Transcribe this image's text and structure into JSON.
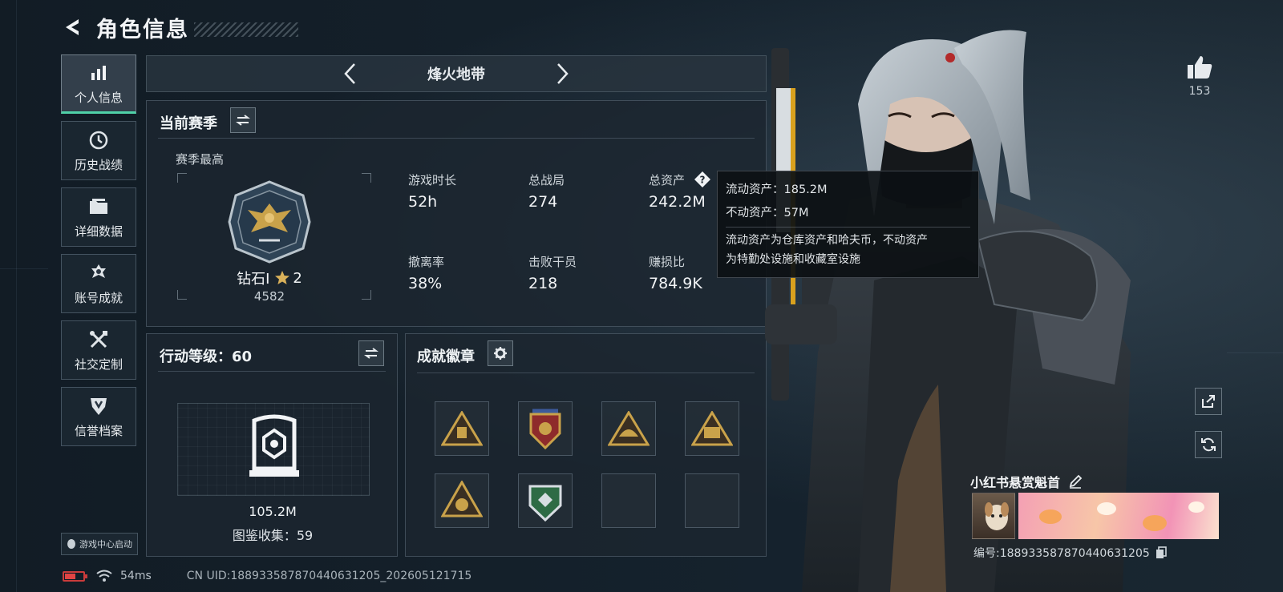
{
  "header": {
    "title": "角色信息"
  },
  "nav": {
    "items": [
      {
        "label": "个人信息",
        "icon": "bar-chart-icon",
        "active": true
      },
      {
        "label": "历史战绩",
        "icon": "clock-icon",
        "active": false
      },
      {
        "label": "详细数据",
        "icon": "folder-icon",
        "active": false
      },
      {
        "label": "账号成就",
        "icon": "medal-icon",
        "active": false
      },
      {
        "label": "社交定制",
        "icon": "tools-icon",
        "active": false
      },
      {
        "label": "信誉档案",
        "icon": "shield-icon",
        "active": false
      }
    ],
    "launch_label": "游戏中心启动"
  },
  "mode": {
    "title": "烽火地带"
  },
  "season": {
    "title": "当前赛季",
    "best_label": "赛季最高",
    "rank_name": "钻石I",
    "rank_stars": "2",
    "rank_score": "4582",
    "stats": [
      {
        "label": "游戏时长",
        "value": "52h"
      },
      {
        "label": "总战局",
        "value": "274"
      },
      {
        "label": "总资产",
        "value": "242.2M"
      },
      {
        "label": "撤离率",
        "value": "38%"
      },
      {
        "label": "击败干员",
        "value": "218"
      },
      {
        "label": "赚损比",
        "value": "784.9K"
      }
    ]
  },
  "tooltip": {
    "liquid": "流动资产：185.2M",
    "fixed": "不动资产：57M",
    "desc_line1": "流动资产为仓库资产和哈夫币，不动资产",
    "desc_line2": "为特勤处设施和收藏室设施"
  },
  "action_level": {
    "title": "行动等级：60",
    "value": "105.2M",
    "collection": "图鉴收集：59"
  },
  "achievements": {
    "title": "成就徽章"
  },
  "profile": {
    "likes": "153",
    "card_name": "小红书悬赏魁首",
    "card_id": "编号:188933587870440631205"
  },
  "status": {
    "ping": "54ms",
    "uid": "CN UID:188933587870440631205_202605121715"
  },
  "colors": {
    "accent": "#4fd1a8",
    "battery_low": "#e04444",
    "gold": "#c9a24a"
  }
}
